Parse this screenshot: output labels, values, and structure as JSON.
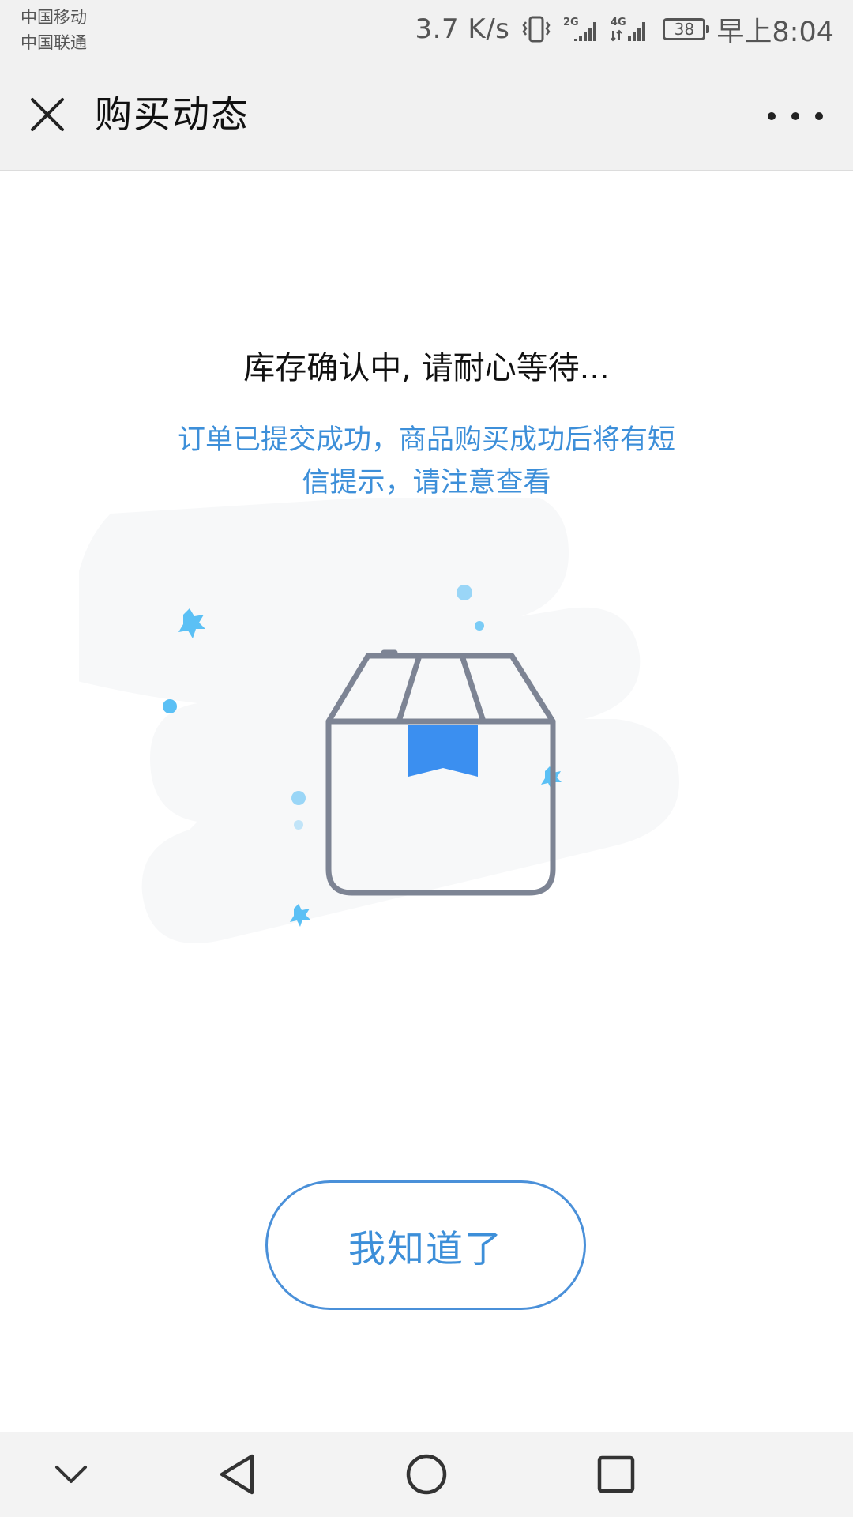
{
  "status_bar": {
    "carrier_1": "中国移动",
    "carrier_2": "中国联通",
    "net_speed": "3.7 K/s",
    "signal_1_label": "2G",
    "signal_2_label": "4G",
    "battery_level": "38",
    "time": "早上8:04",
    "icons": [
      "vibrate-icon",
      "signal-2g-icon",
      "signal-4g-icon",
      "battery-icon"
    ]
  },
  "header": {
    "title": "购买动态",
    "close_icon": "close-icon",
    "more_icon": "more-icon"
  },
  "main": {
    "heading": "库存确认中, 请耐心等待...",
    "message": "订单已提交成功，商品购买成功后将有短信提示，请注意查看",
    "illustration_icon": "package-box-icon"
  },
  "button": {
    "label": "我知道了"
  },
  "nav": {
    "icons": [
      "collapse-icon",
      "back-icon",
      "home-icon",
      "recents-icon"
    ]
  },
  "colors": {
    "accent": "#3d8fd9",
    "box_outline": "#7d8494",
    "box_ribbon": "#3b8ff0",
    "sparkle": "#5bc0f5",
    "bar_bg": "#f1f1f1"
  }
}
